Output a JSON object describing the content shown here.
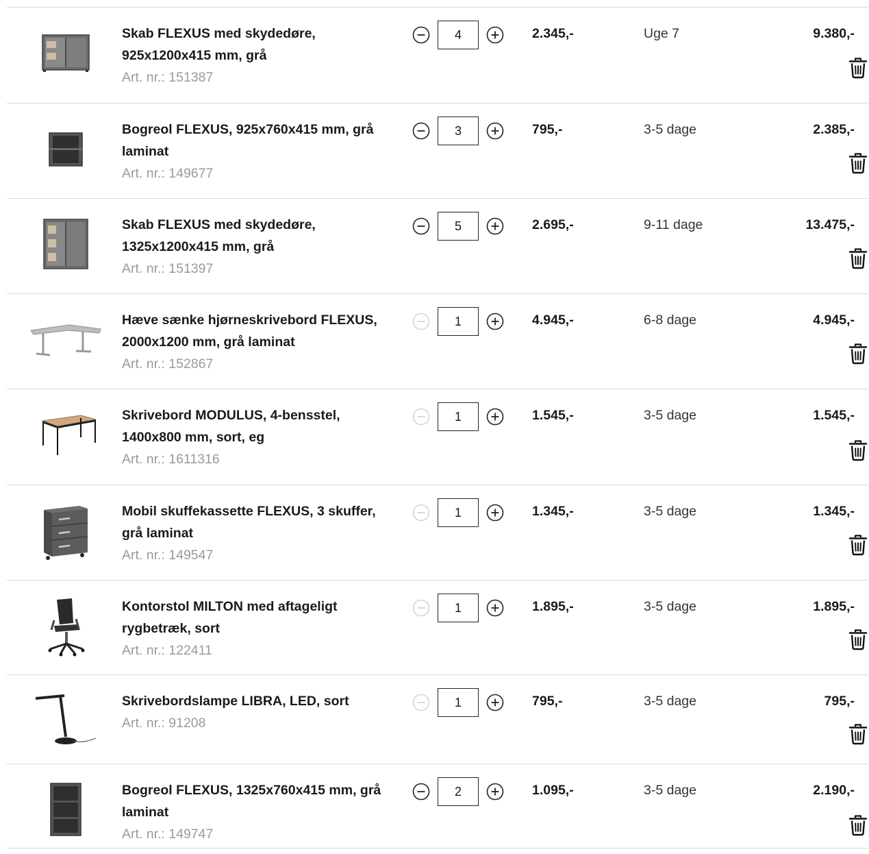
{
  "cart": {
    "items": [
      {
        "name": "Skab FLEXUS med skydedøre, 925x1200x415 mm, grå",
        "art": "Art. nr.: 151387",
        "qty": "4",
        "price": "2.345,-",
        "delivery": "Uge 7",
        "total": "9.380,-",
        "icon": "sliding-door-cabinet-icon",
        "minus_disabled": false
      },
      {
        "name": "Bogreol FLEXUS, 925x760x415 mm, grå laminat",
        "art": "Art. nr.: 149677",
        "qty": "3",
        "price": "795,-",
        "delivery": "3-5 dage",
        "total": "2.385,-",
        "icon": "low-bookshelf-icon",
        "minus_disabled": false
      },
      {
        "name": "Skab FLEXUS med skydedøre, 1325x1200x415 mm, grå",
        "art": "Art. nr.: 151397",
        "qty": "5",
        "price": "2.695,-",
        "delivery": "9-11 dage",
        "total": "13.475,-",
        "icon": "tall-sliding-door-cabinet-icon",
        "minus_disabled": false
      },
      {
        "name": "Hæve sænke hjørneskrivebord FLEXUS, 2000x1200 mm, grå laminat",
        "art": "Art. nr.: 152867",
        "qty": "1",
        "price": "4.945,-",
        "delivery": "6-8 dage",
        "total": "4.945,-",
        "icon": "corner-desk-icon",
        "minus_disabled": true
      },
      {
        "name": "Skrivebord MODULUS, 4-bensstel, 1400x800 mm, sort, eg",
        "art": "Art. nr.: 1611316",
        "qty": "1",
        "price": "1.545,-",
        "delivery": "3-5 dage",
        "total": "1.545,-",
        "icon": "oak-desk-icon",
        "minus_disabled": true
      },
      {
        "name": "Mobil skuffekassette FLEXUS, 3 skuffer, grå laminat",
        "art": "Art. nr.: 149547",
        "qty": "1",
        "price": "1.345,-",
        "delivery": "3-5 dage",
        "total": "1.345,-",
        "icon": "drawer-pedestal-icon",
        "minus_disabled": true
      },
      {
        "name": "Kontorstol MILTON med aftageligt rygbetræk, sort",
        "art": "Art. nr.: 122411",
        "qty": "1",
        "price": "1.895,-",
        "delivery": "3-5 dage",
        "total": "1.895,-",
        "icon": "office-chair-icon",
        "minus_disabled": true
      },
      {
        "name": "Skrivebordslampe LIBRA, LED, sort",
        "art": "Art. nr.: 91208",
        "qty": "1",
        "price": "795,-",
        "delivery": "3-5 dage",
        "total": "795,-",
        "icon": "desk-lamp-icon",
        "minus_disabled": true
      },
      {
        "name": "Bogreol FLEXUS, 1325x760x415 mm, grå laminat",
        "art": "Art. nr.: 149747",
        "qty": "2",
        "price": "1.095,-",
        "delivery": "3-5 dage",
        "total": "2.190,-",
        "icon": "bookshelf-icon",
        "minus_disabled": false
      }
    ]
  },
  "colors": {
    "text": "#1a1a1a",
    "muted": "#9a9a9a",
    "divider": "#d8d8d8",
    "disabled": "#d4d4d4"
  }
}
